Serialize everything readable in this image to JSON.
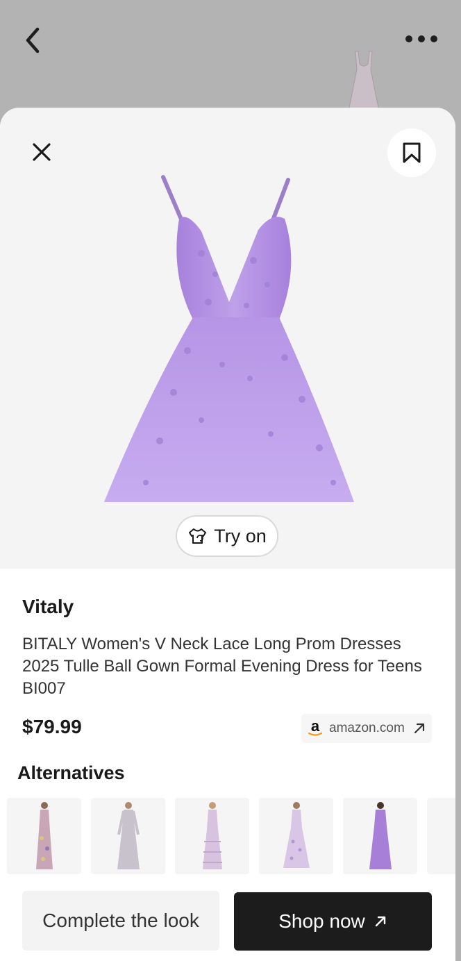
{
  "background": {
    "back_icon": "chevron-left-icon",
    "more_icon": "more-horizontal-icon"
  },
  "sheet": {
    "close_icon": "close-icon",
    "save_icon": "bookmark-icon",
    "try_on": {
      "label": "Try on",
      "icon": "try-on-shirt-icon"
    }
  },
  "product": {
    "brand": "Vitaly",
    "title": "BITALY Women's V Neck Lace Long Prom Dresses 2025 Tulle Ball Gown Formal Evening Dress for Teens BI007",
    "price": "$79.99",
    "store": {
      "name": "amazon.com",
      "logo_icon": "amazon-logo-icon",
      "arrow_icon": "external-arrow-icon"
    },
    "color": "#b99be6"
  },
  "alternatives": {
    "heading": "Alternatives",
    "items": [
      {
        "name": "floral-maxi-dress",
        "color": "#c9a6b6"
      },
      {
        "name": "grey-long-sleeve-gown",
        "color": "#c8c2cc"
      },
      {
        "name": "lilac-ruffle-dress",
        "color": "#d7c3df"
      },
      {
        "name": "lavender-floral-gown",
        "color": "#d9c5e6"
      },
      {
        "name": "purple-chiffon-gown",
        "color": "#a77fd8"
      },
      {
        "name": "lilac-gown-partial",
        "color": "#c9b8e2"
      }
    ]
  },
  "actions": {
    "complete_look_label": "Complete the look",
    "shop_now_label": "Shop now",
    "shop_now_icon": "arrow-up-right-icon"
  }
}
